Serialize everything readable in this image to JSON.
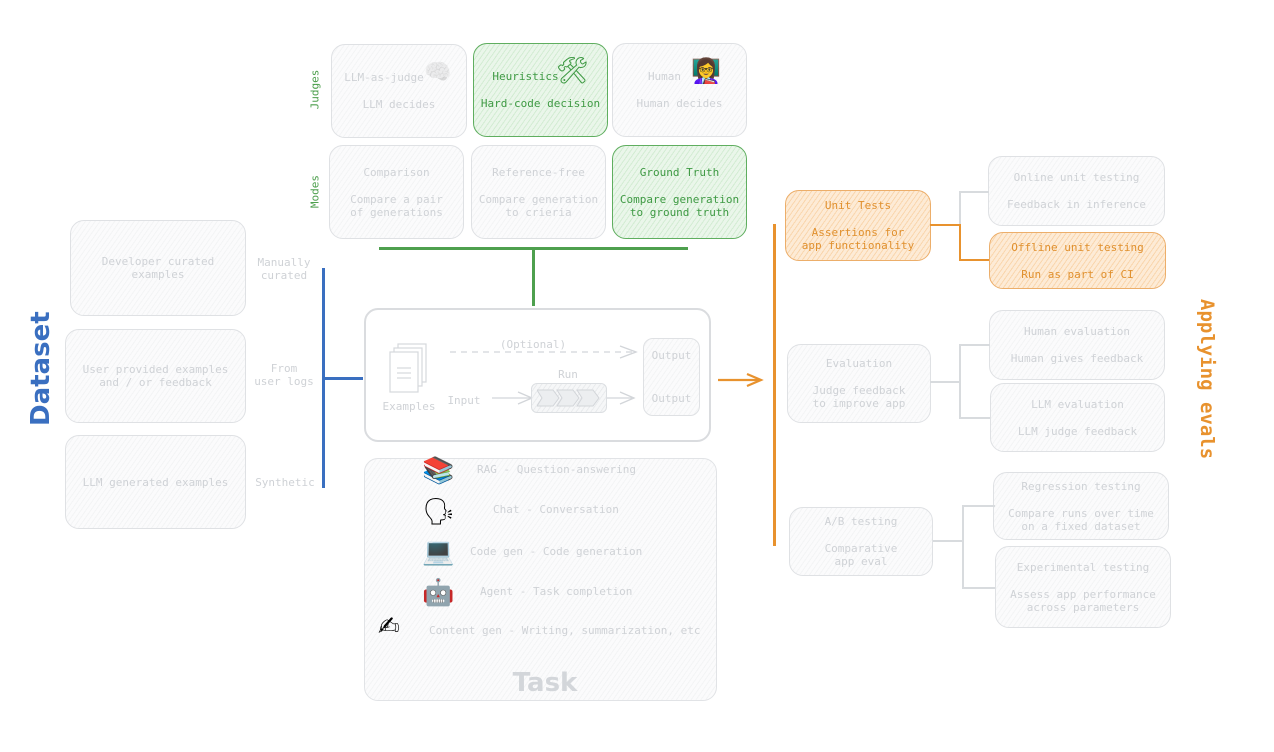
{
  "colors": {
    "dataset_blue": "#3a6fc0",
    "judge_green": "#4ea04e",
    "eval_orange": "#e8922e",
    "muted_grey": "#cfd2d6"
  },
  "dataset": {
    "title": "Dataset",
    "sources": [
      {
        "box": "Developer curated\nexamples",
        "label": "Manually\ncurated"
      },
      {
        "box": "User provided examples\nand / or feedback",
        "label": "From\nuser logs"
      },
      {
        "box": "LLM generated examples",
        "label": "Synthetic"
      }
    ]
  },
  "judges": {
    "row_label": "Judges",
    "items": [
      {
        "title": "LLM-as-judge",
        "desc": "LLM decides",
        "icon": "brain-icon",
        "glyph": "🧠",
        "highlighted": false
      },
      {
        "title": "Heuristics",
        "desc": "Hard-code decision",
        "icon": "hammer-wrench-icon",
        "glyph": "🛠",
        "highlighted": true
      },
      {
        "title": "Human",
        "desc": "Human decides",
        "icon": "teacher-icon",
        "glyph": "👩‍🏫",
        "highlighted": false
      }
    ]
  },
  "modes": {
    "row_label": "Modes",
    "items": [
      {
        "title": "Comparison",
        "desc": "Compare a pair\nof generations",
        "highlighted": false
      },
      {
        "title": "Reference-free",
        "desc": "Compare generation\nto crieria",
        "highlighted": false
      },
      {
        "title": "Ground Truth",
        "desc": "Compare generation\nto ground truth",
        "highlighted": true
      }
    ]
  },
  "pipeline": {
    "optional": "(Optional)",
    "run": "Run",
    "input": "Input",
    "examples": "Examples",
    "output_top": "Output",
    "output_bottom": "Output"
  },
  "task": {
    "title": "Task",
    "items": [
      {
        "icon": "books-icon",
        "glyph": "📚",
        "label": "RAG - Question-answering"
      },
      {
        "icon": "speaking-head-icon",
        "glyph": "🗣",
        "label": "Chat - Conversation"
      },
      {
        "icon": "laptop-icon",
        "glyph": "💻",
        "label": "Code gen - Code generation"
      },
      {
        "icon": "robot-icon",
        "glyph": "🤖",
        "label": "Agent - Task completion"
      },
      {
        "icon": "writing-hand-icon",
        "glyph": "✍",
        "label": "Content gen - Writing, summarization, etc"
      }
    ]
  },
  "applying": {
    "title": "Applying evals",
    "groups": [
      {
        "title": "Unit Tests",
        "desc": "Assertions for\napp functionality",
        "highlighted": true,
        "children": [
          {
            "title": "Online unit testing",
            "desc": "Feedback in inference",
            "highlighted": false
          },
          {
            "title": "Offline unit testing",
            "desc": "Run as part of CI",
            "highlighted": true
          }
        ]
      },
      {
        "title": "Evaluation",
        "desc": "Judge feedback\nto improve app",
        "highlighted": false,
        "children": [
          {
            "title": "Human evaluation",
            "desc": "Human gives feedback",
            "highlighted": false
          },
          {
            "title": "LLM evaluation",
            "desc": "LLM judge feedback",
            "highlighted": false
          }
        ]
      },
      {
        "title": "A/B testing",
        "desc": "Comparative\napp eval",
        "highlighted": false,
        "children": [
          {
            "title": "Regression testing",
            "desc": "Compare runs over time\non a fixed dataset",
            "highlighted": false
          },
          {
            "title": "Experimental testing",
            "desc": "Assess app performance\nacross parameters",
            "highlighted": false
          }
        ]
      }
    ]
  }
}
